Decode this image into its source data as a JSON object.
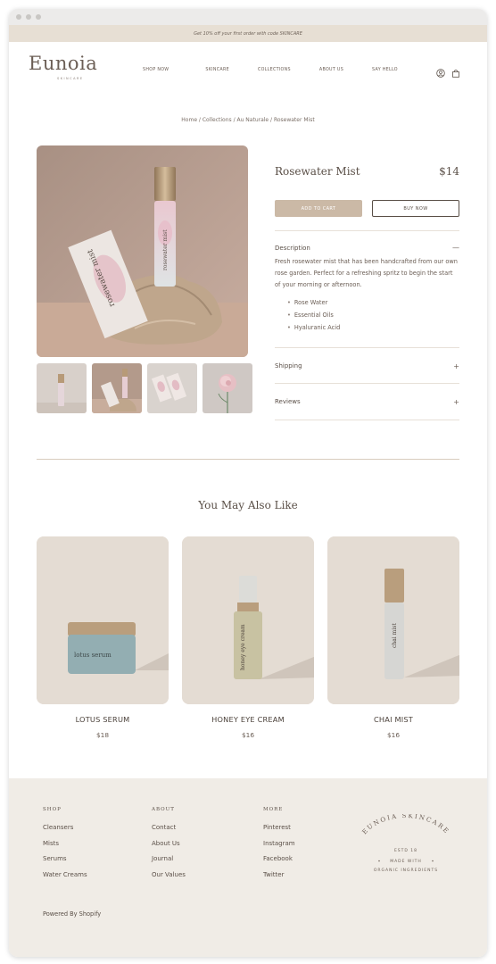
{
  "announcement": "Get 10% off your first order with code SKINCARE",
  "brand": {
    "name": "Eunoia",
    "sub": "SKINCARE"
  },
  "nav": [
    "SHOP NOW",
    "SKINCARE",
    "COLLECTIONS",
    "ABOUT US",
    "SAY HELLO"
  ],
  "breadcrumb": "Home / Collections / Au Naturale / Rosewater Mist",
  "product": {
    "title": "Rosewater Mist",
    "price": "$14",
    "add_to_cart": "ADD TO CART",
    "buy_now": "BUY NOW",
    "description_label": "Description",
    "description": "Fresh rosewater mist that has been handcrafted from our own rose garden. Perfect for a refreshing spritz to begin the start of your morning or afternoon.",
    "ingredients": [
      "Rose Water",
      "Essential Oils",
      "Hyaluranic Acid"
    ],
    "shipping_label": "Shipping",
    "reviews_label": "Reviews",
    "collapse_symbol": "—",
    "expand_symbol": "+",
    "bottle_text": "rosewater mist",
    "box_text": "rosewater mist"
  },
  "also_like": {
    "heading": "You May Also Like",
    "items": [
      {
        "name": "LOTUS SERUM",
        "price": "$18",
        "label": "lotus serum"
      },
      {
        "name": "HONEY EYE CREAM",
        "price": "$16",
        "label": "honey eye cream"
      },
      {
        "name": "CHAI MIST",
        "price": "$16",
        "label": "chai mist"
      }
    ]
  },
  "footer": {
    "shop": {
      "heading": "SHOP",
      "links": [
        "Cleansers",
        "Mists",
        "Serums",
        "Water Creams"
      ]
    },
    "about": {
      "heading": "ABOUT",
      "links": [
        "Contact",
        "About Us",
        "Journal",
        "Our Values"
      ]
    },
    "more": {
      "heading": "MORE",
      "links": [
        "Pinterest",
        "Instagram",
        "Facebook",
        "Twitter"
      ]
    },
    "seal": {
      "arc": "EUNOIA SKINCARE",
      "estd": "ESTD 18",
      "line1": "MADE WITH",
      "line2": "ORGANIC INGREDIENTS"
    },
    "powered": "Powered By Shopify"
  },
  "colors": {
    "announce_bg": "#e7dfd4",
    "cart_button": "#cbb9a6",
    "footer_bg": "#f0ece6",
    "text": "#5a4f47"
  },
  "icons": [
    "account-icon",
    "bag-icon"
  ]
}
